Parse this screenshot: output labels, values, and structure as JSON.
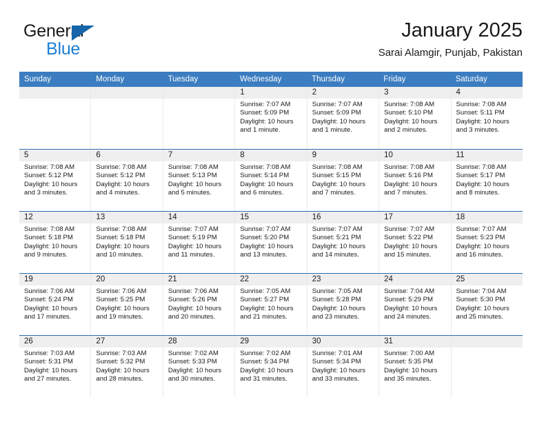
{
  "brand": {
    "line1": "General",
    "line2": "Blue",
    "icon": "triangle-logo"
  },
  "header": {
    "title": "January 2025",
    "subtitle": "Sarai Alamgir, Punjab, Pakistan"
  },
  "calendar": {
    "weekdays": [
      "Sunday",
      "Monday",
      "Tuesday",
      "Wednesday",
      "Thursday",
      "Friday",
      "Saturday"
    ],
    "colors": {
      "header_blue": "#3b7dc0",
      "row_divider_blue": "#2a6dad",
      "day_band_gray": "#efefef",
      "brand_blue": "#1b7fd4",
      "logo_blue": "#1565a8"
    },
    "weeks": [
      [
        {
          "day": "",
          "empty": true
        },
        {
          "day": "",
          "empty": true
        },
        {
          "day": "",
          "empty": true
        },
        {
          "day": "1",
          "sunrise": "Sunrise: 7:07 AM",
          "sunset": "Sunset: 5:09 PM",
          "daylight1": "Daylight: 10 hours",
          "daylight2": "and 1 minute."
        },
        {
          "day": "2",
          "sunrise": "Sunrise: 7:07 AM",
          "sunset": "Sunset: 5:09 PM",
          "daylight1": "Daylight: 10 hours",
          "daylight2": "and 1 minute."
        },
        {
          "day": "3",
          "sunrise": "Sunrise: 7:08 AM",
          "sunset": "Sunset: 5:10 PM",
          "daylight1": "Daylight: 10 hours",
          "daylight2": "and 2 minutes."
        },
        {
          "day": "4",
          "sunrise": "Sunrise: 7:08 AM",
          "sunset": "Sunset: 5:11 PM",
          "daylight1": "Daylight: 10 hours",
          "daylight2": "and 3 minutes."
        }
      ],
      [
        {
          "day": "5",
          "sunrise": "Sunrise: 7:08 AM",
          "sunset": "Sunset: 5:12 PM",
          "daylight1": "Daylight: 10 hours",
          "daylight2": "and 3 minutes."
        },
        {
          "day": "6",
          "sunrise": "Sunrise: 7:08 AM",
          "sunset": "Sunset: 5:12 PM",
          "daylight1": "Daylight: 10 hours",
          "daylight2": "and 4 minutes."
        },
        {
          "day": "7",
          "sunrise": "Sunrise: 7:08 AM",
          "sunset": "Sunset: 5:13 PM",
          "daylight1": "Daylight: 10 hours",
          "daylight2": "and 5 minutes."
        },
        {
          "day": "8",
          "sunrise": "Sunrise: 7:08 AM",
          "sunset": "Sunset: 5:14 PM",
          "daylight1": "Daylight: 10 hours",
          "daylight2": "and 6 minutes."
        },
        {
          "day": "9",
          "sunrise": "Sunrise: 7:08 AM",
          "sunset": "Sunset: 5:15 PM",
          "daylight1": "Daylight: 10 hours",
          "daylight2": "and 7 minutes."
        },
        {
          "day": "10",
          "sunrise": "Sunrise: 7:08 AM",
          "sunset": "Sunset: 5:16 PM",
          "daylight1": "Daylight: 10 hours",
          "daylight2": "and 7 minutes."
        },
        {
          "day": "11",
          "sunrise": "Sunrise: 7:08 AM",
          "sunset": "Sunset: 5:17 PM",
          "daylight1": "Daylight: 10 hours",
          "daylight2": "and 8 minutes."
        }
      ],
      [
        {
          "day": "12",
          "sunrise": "Sunrise: 7:08 AM",
          "sunset": "Sunset: 5:18 PM",
          "daylight1": "Daylight: 10 hours",
          "daylight2": "and 9 minutes."
        },
        {
          "day": "13",
          "sunrise": "Sunrise: 7:08 AM",
          "sunset": "Sunset: 5:18 PM",
          "daylight1": "Daylight: 10 hours",
          "daylight2": "and 10 minutes."
        },
        {
          "day": "14",
          "sunrise": "Sunrise: 7:07 AM",
          "sunset": "Sunset: 5:19 PM",
          "daylight1": "Daylight: 10 hours",
          "daylight2": "and 11 minutes."
        },
        {
          "day": "15",
          "sunrise": "Sunrise: 7:07 AM",
          "sunset": "Sunset: 5:20 PM",
          "daylight1": "Daylight: 10 hours",
          "daylight2": "and 13 minutes."
        },
        {
          "day": "16",
          "sunrise": "Sunrise: 7:07 AM",
          "sunset": "Sunset: 5:21 PM",
          "daylight1": "Daylight: 10 hours",
          "daylight2": "and 14 minutes."
        },
        {
          "day": "17",
          "sunrise": "Sunrise: 7:07 AM",
          "sunset": "Sunset: 5:22 PM",
          "daylight1": "Daylight: 10 hours",
          "daylight2": "and 15 minutes."
        },
        {
          "day": "18",
          "sunrise": "Sunrise: 7:07 AM",
          "sunset": "Sunset: 5:23 PM",
          "daylight1": "Daylight: 10 hours",
          "daylight2": "and 16 minutes."
        }
      ],
      [
        {
          "day": "19",
          "sunrise": "Sunrise: 7:06 AM",
          "sunset": "Sunset: 5:24 PM",
          "daylight1": "Daylight: 10 hours",
          "daylight2": "and 17 minutes."
        },
        {
          "day": "20",
          "sunrise": "Sunrise: 7:06 AM",
          "sunset": "Sunset: 5:25 PM",
          "daylight1": "Daylight: 10 hours",
          "daylight2": "and 19 minutes."
        },
        {
          "day": "21",
          "sunrise": "Sunrise: 7:06 AM",
          "sunset": "Sunset: 5:26 PM",
          "daylight1": "Daylight: 10 hours",
          "daylight2": "and 20 minutes."
        },
        {
          "day": "22",
          "sunrise": "Sunrise: 7:05 AM",
          "sunset": "Sunset: 5:27 PM",
          "daylight1": "Daylight: 10 hours",
          "daylight2": "and 21 minutes."
        },
        {
          "day": "23",
          "sunrise": "Sunrise: 7:05 AM",
          "sunset": "Sunset: 5:28 PM",
          "daylight1": "Daylight: 10 hours",
          "daylight2": "and 23 minutes."
        },
        {
          "day": "24",
          "sunrise": "Sunrise: 7:04 AM",
          "sunset": "Sunset: 5:29 PM",
          "daylight1": "Daylight: 10 hours",
          "daylight2": "and 24 minutes."
        },
        {
          "day": "25",
          "sunrise": "Sunrise: 7:04 AM",
          "sunset": "Sunset: 5:30 PM",
          "daylight1": "Daylight: 10 hours",
          "daylight2": "and 25 minutes."
        }
      ],
      [
        {
          "day": "26",
          "sunrise": "Sunrise: 7:03 AM",
          "sunset": "Sunset: 5:31 PM",
          "daylight1": "Daylight: 10 hours",
          "daylight2": "and 27 minutes."
        },
        {
          "day": "27",
          "sunrise": "Sunrise: 7:03 AM",
          "sunset": "Sunset: 5:32 PM",
          "daylight1": "Daylight: 10 hours",
          "daylight2": "and 28 minutes."
        },
        {
          "day": "28",
          "sunrise": "Sunrise: 7:02 AM",
          "sunset": "Sunset: 5:33 PM",
          "daylight1": "Daylight: 10 hours",
          "daylight2": "and 30 minutes."
        },
        {
          "day": "29",
          "sunrise": "Sunrise: 7:02 AM",
          "sunset": "Sunset: 5:34 PM",
          "daylight1": "Daylight: 10 hours",
          "daylight2": "and 31 minutes."
        },
        {
          "day": "30",
          "sunrise": "Sunrise: 7:01 AM",
          "sunset": "Sunset: 5:34 PM",
          "daylight1": "Daylight: 10 hours",
          "daylight2": "and 33 minutes."
        },
        {
          "day": "31",
          "sunrise": "Sunrise: 7:00 AM",
          "sunset": "Sunset: 5:35 PM",
          "daylight1": "Daylight: 10 hours",
          "daylight2": "and 35 minutes."
        },
        {
          "day": "",
          "empty": true
        }
      ]
    ]
  }
}
